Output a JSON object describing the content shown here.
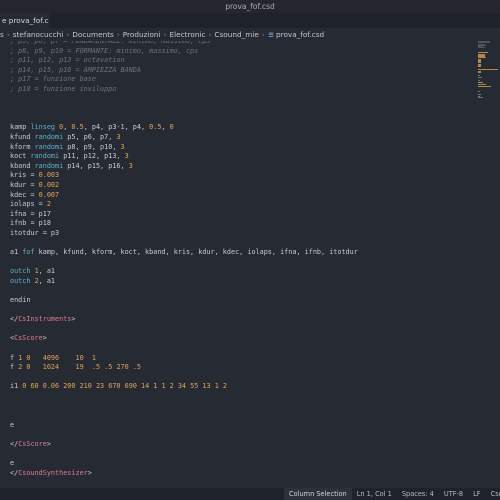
{
  "window": {
    "title": "prova_fof.csd"
  },
  "tabs": [
    {
      "label": "e prova_fof.csd"
    }
  ],
  "breadcrumb": {
    "items": [
      "s",
      "stefanocucchi",
      "Documents",
      "Produzioni",
      "Electronic",
      "Csound_mie"
    ],
    "file_icon": "≡",
    "file": "prova_fof.csd"
  },
  "code_lines": [
    "; p5, p6, p7 = FONDAMENTALE: minimo, massimo, cps",
    "; p8, p9, p10 = FORMANTE: minimo, massimo, cps",
    "; p11, p12, p13 = octavation",
    "; p14, p15, p16 = AMPIEZZA BANDA",
    "; p17 = funzione base",
    "; p18 = funzione inviluppo",
    "",
    "",
    "",
    "kamp linseg 0, 0.5, p4, p3-1, p4, 0.5, 0",
    "kfund randomi p5, p6, p7, 3",
    "kform randomi p8, p9, p10, 3",
    "koct randomi p11, p12, p13, 3",
    "kband randomi p14, p15, p16, 3",
    "kris = 0.003",
    "kdur = 0.002",
    "kdec = 0.007",
    "iolaps = 2",
    "ifna = p17",
    "ifnb = p18",
    "itotdur = p3",
    "",
    "a1 fof kamp, kfund, kform, koct, kband, kris, kdur, kdec, iolaps, ifna, ifnb, itotdur",
    "",
    "outch 1, a1",
    "outch 2, a1",
    "",
    "endin",
    "",
    "</CsInstruments>",
    "",
    "<CsScore>",
    "",
    "f 1 0   4096    10  1",
    "f 2 0   1024    19  .5 .5 270 .5",
    "",
    "i1 0 60 0.06 200 210 23 670 690 14 1 1 2 34 55 13 1 2",
    "",
    "",
    "",
    "e",
    "",
    "</CsScore>",
    "",
    "e",
    "</CsoundSynthesizer>"
  ],
  "statusbar": {
    "selection_mode": "Column Selection",
    "cursor": "Ln 1, Col 1",
    "spaces": "Spaces: 4",
    "encoding": "UTF-8",
    "eol": "LF",
    "language": "Csound C"
  },
  "colors": {
    "background": "#262a33",
    "comment": "#6d727b",
    "keyword": "#5fb3c9",
    "number": "#e0a458",
    "tag": "#e07a8f",
    "text": "#c9ccd1"
  },
  "icons": {
    "file": "file-icon"
  }
}
